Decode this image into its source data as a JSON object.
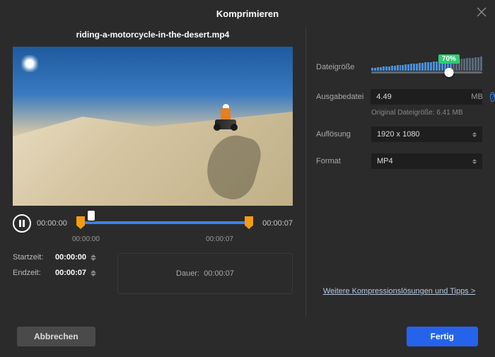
{
  "header": {
    "title": "Komprimieren"
  },
  "file": {
    "name": "riding-a-motorcycle-in-the-desert.mp4"
  },
  "player": {
    "current_time": "00:00:00",
    "total_time": "00:00:07",
    "track_start": "00:00:00",
    "track_end": "00:00:07"
  },
  "trim": {
    "start_label": "Startzeit:",
    "start_value": "00:00:00",
    "end_label": "Endzeit:",
    "end_value": "00:00:07",
    "duration_label": "Dauer:",
    "duration_value": "00:00:07"
  },
  "settings": {
    "filesize_label": "Dateigröße",
    "filesize_percent": "70%",
    "output_label": "Ausgabedatei",
    "output_value": "4.49",
    "output_unit": "MB",
    "original_hint": "Original Dateigröße: 6.41 MB",
    "resolution_label": "Auflösung",
    "resolution_value": "1920 x 1080",
    "format_label": "Format",
    "format_value": "MP4"
  },
  "tips_link": "Weitere Kompressionslösungen und Tipps >",
  "footer": {
    "cancel": "Abbrechen",
    "done": "Fertig"
  }
}
